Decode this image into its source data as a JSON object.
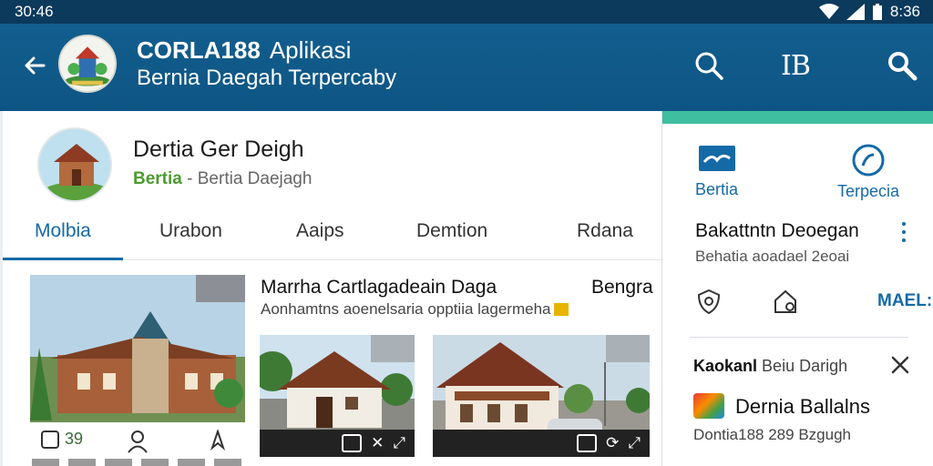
{
  "status": {
    "time_left": "30:46",
    "time_right": "8:36"
  },
  "appbar": {
    "title": "CORLA188",
    "title_suffix": "Aplikasi",
    "subtitle": "Bernia Daegah Terpercaby",
    "icons": [
      "back-arrow-icon",
      "search-icon",
      "translate-icon",
      "search-icon"
    ],
    "translate_text": "IB"
  },
  "profile": {
    "name": "Dertia Ger Deigh",
    "sub_highlight": "Bertia",
    "sub_rest": "- Bertia Daejagh"
  },
  "tabs": [
    "Molbia",
    "Urabon",
    "Aaips",
    "Demtion",
    "Rdana"
  ],
  "feed": {
    "card1_stat": "39",
    "headline": "Marrha Cartlagadeain Daga",
    "headline_right": "Bengra",
    "description": "Aonhamtns aoenelsaria opptiia lagermeha"
  },
  "side": {
    "nav": [
      {
        "label": "Bertia",
        "icon": "news-icon"
      },
      {
        "label": "Terpecia",
        "icon": "compass-icon"
      }
    ],
    "title": "Bakattntn Deoegan",
    "subtitle": "Behatia aoadael 2eoai",
    "action_label": "MAEL::",
    "notif_head_bold": "Kaokanl",
    "notif_head_rest": "Beiu Darigh",
    "notif_title": "Dernia Ballalns",
    "notif_sub": "Dontia188 289 Bzgugh"
  },
  "colors": {
    "appbar": "#125e8e",
    "accent": "#146aa6",
    "teal": "#3fbea0",
    "green": "#4d9c2f"
  }
}
